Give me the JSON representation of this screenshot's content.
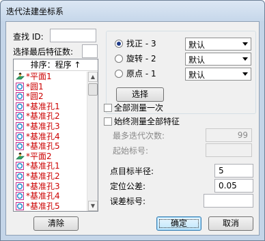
{
  "window": {
    "title": "迭代法建坐标系"
  },
  "search": {
    "label": "查找 ID:",
    "value": ""
  },
  "select_last": {
    "label": "选择最后特征数:",
    "value": ""
  },
  "list": {
    "header": "排序：程序 ↑",
    "items": [
      {
        "label": "*平面1",
        "icon": "plane-icon"
      },
      {
        "label": "*圆1",
        "icon": "circle-feature-icon"
      },
      {
        "label": "*圆2",
        "icon": "circle-feature-icon"
      },
      {
        "label": "*基准孔1",
        "icon": "circle-feature-icon"
      },
      {
        "label": "*基准孔2",
        "icon": "circle-feature-icon"
      },
      {
        "label": "*基准孔3",
        "icon": "circle-feature-icon"
      },
      {
        "label": "*基准孔4",
        "icon": "circle-feature-icon"
      },
      {
        "label": "*基准孔5",
        "icon": "circle-feature-icon"
      },
      {
        "label": "*平面2",
        "icon": "plane-icon"
      },
      {
        "label": "*基准孔1",
        "icon": "circle-feature-icon"
      },
      {
        "label": "*基准孔2",
        "icon": "circle-feature-icon"
      },
      {
        "label": "*基准孔3",
        "icon": "circle-feature-icon"
      },
      {
        "label": "*基准孔4",
        "icon": "circle-feature-icon"
      },
      {
        "label": "*基准孔5",
        "icon": "circle-feature-icon"
      }
    ]
  },
  "options": {
    "radios": [
      {
        "label": "找正 - 3",
        "selected": true,
        "combo": "默认"
      },
      {
        "label": "旋转 - 2",
        "selected": false,
        "combo": "默认"
      },
      {
        "label": "原点 - 1",
        "selected": false,
        "combo": "默认"
      }
    ],
    "select_button": "选择"
  },
  "measure_all_once": {
    "label": "全部测量一次",
    "checked": false
  },
  "always_measure_all": {
    "label": "始终测量全部特征",
    "checked": false
  },
  "max_iterations": {
    "label": "最多迭代次数:",
    "value": "99"
  },
  "start_label": {
    "label": "起始标号:",
    "value": ""
  },
  "target_radius": {
    "label": "点目标半径:",
    "value": "5"
  },
  "position_tolerance": {
    "label": "定位公差:",
    "value": "0.05"
  },
  "error_label": {
    "label": "误差标号:",
    "value": ""
  },
  "buttons": {
    "clear": "清除",
    "ok": "确定",
    "cancel": "取消"
  },
  "colors": {
    "feature_text": "#cc0000",
    "title_bar": "#c6d7ea",
    "client_bg": "#f0f0f0"
  }
}
